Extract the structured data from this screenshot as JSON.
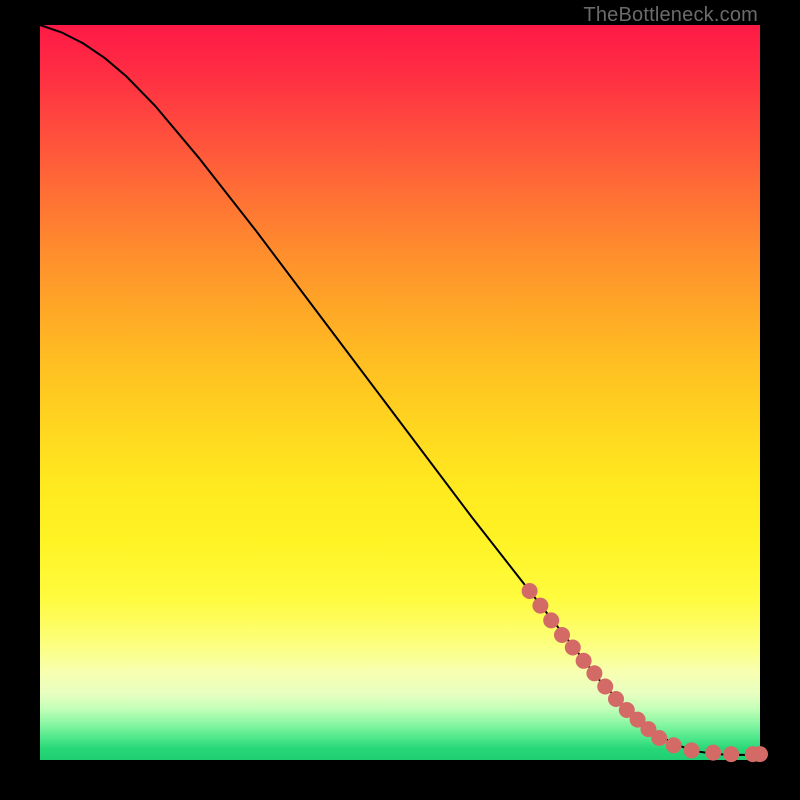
{
  "attribution": "TheBottleneck.com",
  "colors": {
    "marker": "#d46a66",
    "curve": "#000000"
  },
  "chart_data": {
    "type": "line",
    "title": "",
    "xlabel": "",
    "ylabel": "",
    "xlim": [
      0,
      100
    ],
    "ylim": [
      0,
      100
    ],
    "series": [
      {
        "name": "bottleneck-curve",
        "x": [
          0,
          3,
          6,
          9,
          12,
          16,
          22,
          30,
          40,
          50,
          60,
          68,
          74,
          78,
          82,
          85,
          88,
          91,
          94,
          96,
          98,
          100
        ],
        "y": [
          100,
          99,
          97.5,
          95.5,
          93,
          89,
          82,
          72,
          59,
          46,
          33,
          23,
          15.5,
          10.5,
          6.5,
          4,
          2.2,
          1.2,
          0.8,
          0.7,
          0.7,
          0.7
        ]
      }
    ],
    "markers": [
      {
        "x": 68.0,
        "y": 23.0
      },
      {
        "x": 69.5,
        "y": 21.0
      },
      {
        "x": 71.0,
        "y": 19.0
      },
      {
        "x": 72.5,
        "y": 17.0
      },
      {
        "x": 74.0,
        "y": 15.3
      },
      {
        "x": 75.5,
        "y": 13.5
      },
      {
        "x": 77.0,
        "y": 11.8
      },
      {
        "x": 78.5,
        "y": 10.0
      },
      {
        "x": 80.0,
        "y": 8.3
      },
      {
        "x": 81.5,
        "y": 6.8
      },
      {
        "x": 83.0,
        "y": 5.5
      },
      {
        "x": 84.5,
        "y": 4.2
      },
      {
        "x": 86.0,
        "y": 3.0
      },
      {
        "x": 88.0,
        "y": 2.0
      },
      {
        "x": 90.5,
        "y": 1.3
      },
      {
        "x": 93.5,
        "y": 1.0
      },
      {
        "x": 96.0,
        "y": 0.8
      },
      {
        "x": 99.0,
        "y": 0.8
      },
      {
        "x": 100.0,
        "y": 0.8
      }
    ]
  }
}
